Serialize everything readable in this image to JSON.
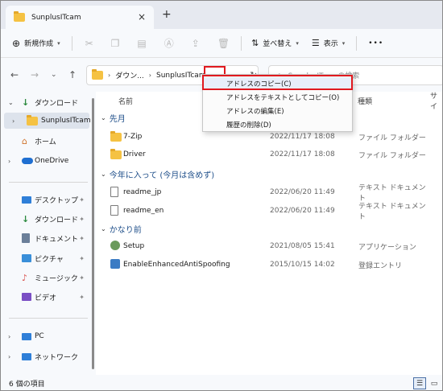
{
  "tab": {
    "title": "SunplusITcam",
    "close": "×",
    "new": "+"
  },
  "toolbar": {
    "new_label": "新規作成",
    "sort_label": "並べ替え",
    "view_label": "表示",
    "more": "•••"
  },
  "address": {
    "crumbs": [
      "ダウン...",
      "SunplusITcam"
    ],
    "search_placeholder": "SunplusITcamの検索"
  },
  "sidebar": {
    "items": [
      {
        "label": "ダウンロード"
      },
      {
        "label": "SunplusITcam"
      },
      {
        "label": "ホーム"
      },
      {
        "label": "OneDrive"
      },
      {
        "label": "デスクトップ"
      },
      {
        "label": "ダウンロード"
      },
      {
        "label": "ドキュメント"
      },
      {
        "label": "ピクチャ"
      },
      {
        "label": "ミュージック"
      },
      {
        "label": "ビデオ"
      },
      {
        "label": "PC"
      },
      {
        "label": "ネットワーク"
      }
    ]
  },
  "columns": {
    "name": "名前",
    "type": "種類",
    "size": "サイ"
  },
  "groups": [
    {
      "label": "先月"
    },
    {
      "label": "今年に入って (今月は含めず)"
    },
    {
      "label": "かなり前"
    }
  ],
  "files": [
    {
      "name": "7-Zip",
      "date": "2022/11/17 18:08",
      "type": "ファイル フォルダー"
    },
    {
      "name": "Driver",
      "date": "2022/11/17 18:08",
      "type": "ファイル フォルダー"
    },
    {
      "name": "readme_jp",
      "date": "2022/06/20 11:49",
      "type": "テキスト ドキュメント"
    },
    {
      "name": "readme_en",
      "date": "2022/06/20 11:49",
      "type": "テキスト ドキュメント"
    },
    {
      "name": "Setup",
      "date": "2021/08/05 15:41",
      "type": "アプリケーション"
    },
    {
      "name": "EnableEnhancedAntiSpoofing",
      "date": "2015/10/15 14:02",
      "type": "登録エントリ"
    }
  ],
  "context_menu": {
    "items": [
      {
        "label": "アドレスのコピー(C)"
      },
      {
        "label": "アドレスをテキストとしてコピー(O)"
      },
      {
        "label": "アドレスの編集(E)"
      },
      {
        "label": "履歴の削除(D)"
      }
    ]
  },
  "status": {
    "count": "6 個の項目"
  },
  "colors": {
    "highlight": "#e0191f",
    "folder": "#f5c243",
    "group": "#1f4f8a"
  }
}
